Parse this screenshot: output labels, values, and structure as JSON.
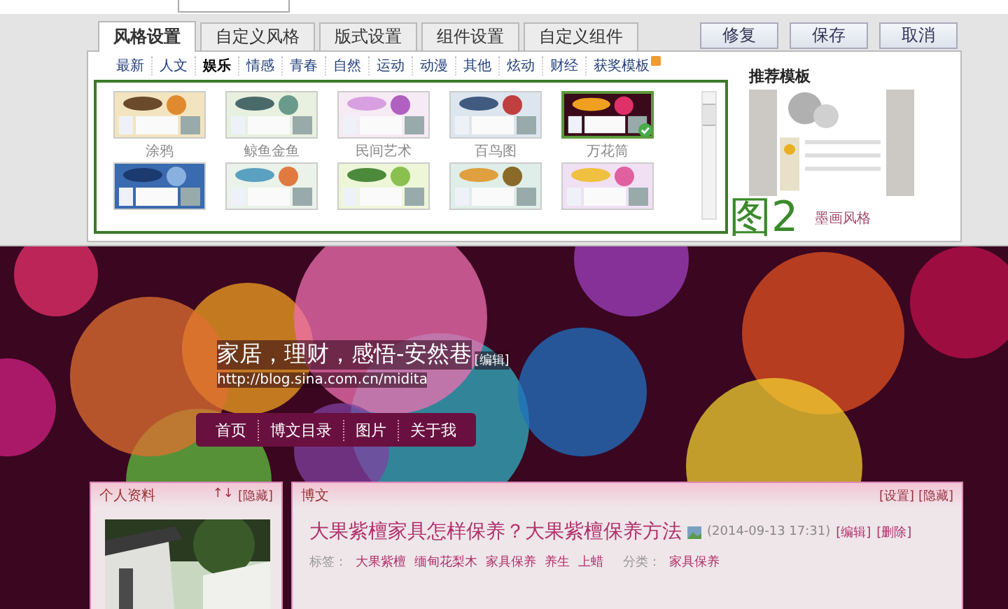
{
  "editor": {
    "tabs": [
      {
        "label": "风格设置",
        "selected": true
      },
      {
        "label": "自定义风格",
        "selected": false
      },
      {
        "label": "版式设置",
        "selected": false
      },
      {
        "label": "组件设置",
        "selected": false
      },
      {
        "label": "自定义组件",
        "selected": false
      }
    ],
    "buttons": [
      "修复",
      "保存",
      "取消"
    ],
    "categories": [
      {
        "label": "最新",
        "selected": false
      },
      {
        "label": "人文",
        "selected": false
      },
      {
        "label": "娱乐",
        "selected": true
      },
      {
        "label": "情感",
        "selected": false
      },
      {
        "label": "青春",
        "selected": false
      },
      {
        "label": "自然",
        "selected": false
      },
      {
        "label": "运动",
        "selected": false
      },
      {
        "label": "动漫",
        "selected": false
      },
      {
        "label": "其他",
        "selected": false
      },
      {
        "label": "炫动",
        "selected": false
      },
      {
        "label": "财经",
        "selected": false
      },
      {
        "label": "获奖模板",
        "selected": false
      }
    ],
    "templates": [
      {
        "label": "涂鸦",
        "selected": false
      },
      {
        "label": "鲸鱼金鱼",
        "selected": false
      },
      {
        "label": "民间艺术",
        "selected": false
      },
      {
        "label": "百鸟图",
        "selected": false
      },
      {
        "label": "万花筒",
        "selected": true
      },
      {
        "selected": false
      },
      {
        "selected": false
      },
      {
        "selected": false
      },
      {
        "selected": false
      },
      {
        "selected": false
      }
    ],
    "recommend": {
      "title": "推荐模板",
      "name": "墨画风格"
    },
    "annotation": "图2"
  },
  "blog": {
    "title": "家居，理财，感悟-安然巷",
    "edit": "[编辑]",
    "url": "http://blog.sina.com.cn/midita",
    "nav": [
      "首页",
      "博文目录",
      "图片",
      "关于我"
    ],
    "profile": {
      "title": "个人资料",
      "arrows": "↑↓",
      "hide": "[隐藏]"
    },
    "posts": {
      "title": "博文",
      "settings": "[设置]",
      "hide": "[隐藏]",
      "post": {
        "title": "大果紫檀家具怎样保养？大果紫檀保养方法",
        "date": "(2014-09-13 17:31)",
        "edit": "[编辑]",
        "delete": "[删除]",
        "tags_label": "标签：",
        "tags": [
          "大果紫檀",
          "缅甸花梨木",
          "家具保养",
          "养生",
          "上蜡"
        ],
        "category_label": "分类：",
        "category": "家具保养"
      }
    }
  }
}
